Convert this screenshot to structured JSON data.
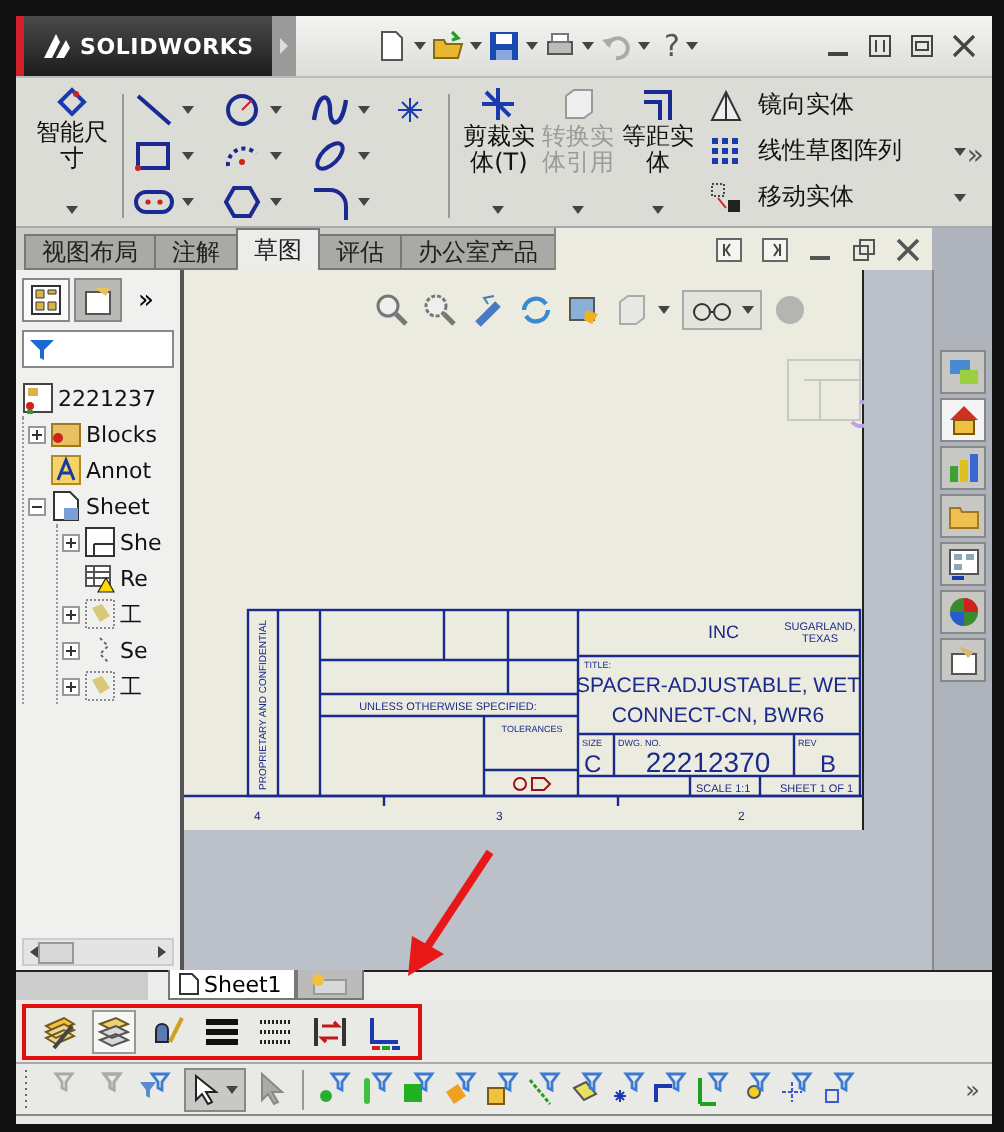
{
  "app": {
    "logo": "SOLIDWORKS",
    "help": "?"
  },
  "ribbon": {
    "big_tools": [
      {
        "label": "剪裁实体(T)",
        "disabled": false
      },
      {
        "label": "转换实体引用",
        "disabled": true
      },
      {
        "label": "等距实体",
        "disabled": false
      }
    ],
    "smart_dimension": "智能尺寸",
    "small_tools": [
      "镜向实体",
      "线性草图阵列",
      "移动实体"
    ],
    "more": "»"
  },
  "tabs": [
    {
      "label": "视图布局",
      "selected": false
    },
    {
      "label": "注解",
      "selected": false
    },
    {
      "label": "草图",
      "selected": true
    },
    {
      "label": "评估",
      "selected": false
    },
    {
      "label": "办公室产品",
      "selected": false
    }
  ],
  "panel": {
    "more": "»",
    "tree": {
      "label": "2221237",
      "children": [
        {
          "label": "Blocks",
          "expanded": false
        },
        {
          "label": "Annot"
        },
        {
          "label": "Sheet",
          "expanded": true,
          "children": [
            {
              "label": "She",
              "expanded": false
            },
            {
              "label": "Re"
            },
            {
              "label": "工",
              "expanded": false
            },
            {
              "label": "Se",
              "expanded": false
            },
            {
              "label": "工",
              "expanded": false
            }
          ]
        }
      ]
    }
  },
  "title_block": {
    "company": "INC",
    "location": [
      "SUGARLAND,",
      "TEXAS"
    ],
    "title_caption": "TITLE:",
    "title": [
      "SPACER-ADJUSTABLE, WET",
      "CONNECT-CN, BWR6"
    ],
    "unless": "UNLESS OTHERWISE SPECIFIED:",
    "tolerances": "TOLERANCES",
    "size_caption": "SIZE",
    "size": "C",
    "dwg_caption": "DWG. NO.",
    "dwg_no": "22212370",
    "rev_caption": "REV",
    "rev": "B",
    "scale": "SCALE 1:1",
    "sheet": "SHEET 1 OF 1",
    "proprietary": "PROPRIETARY AND CONFIDENTIAL",
    "zones": [
      "4",
      "3",
      "2"
    ]
  },
  "sheet_tabs": [
    {
      "label": "Sheet1",
      "selected": true
    }
  ],
  "format_tools": [
    {
      "selected": false
    },
    {
      "selected": true
    },
    {
      "selected": false
    },
    {
      "selected": false
    },
    {
      "selected": false
    },
    {
      "selected": false
    },
    {
      "selected": false
    }
  ],
  "select_tool": {
    "selected": true
  },
  "filters_more": "»"
}
